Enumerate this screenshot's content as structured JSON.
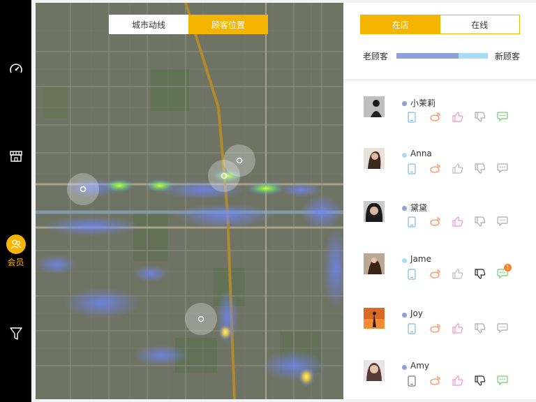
{
  "nav": {
    "items": [
      {
        "id": "dashboard",
        "icon": "speedometer-icon",
        "active": false
      },
      {
        "id": "store",
        "icon": "store-icon",
        "active": false
      },
      {
        "id": "members",
        "icon": "members-icon",
        "active": true,
        "label": "会员"
      },
      {
        "id": "funnel",
        "icon": "funnel-icon",
        "active": false
      }
    ],
    "active_color": "#f5b400"
  },
  "map": {
    "toggle": {
      "city_route": "城市动线",
      "customer_location": "顾客位置",
      "selected": "customer_location"
    }
  },
  "panel": {
    "tabs": {
      "in_store": "在店",
      "online": "在线",
      "selected": "in_store"
    },
    "ratio": {
      "old_label": "老顾客",
      "new_label": "新顾客",
      "old_fraction": 0.68,
      "old_color": "#8f9fdc",
      "new_color": "#a8dcf4"
    },
    "customers": [
      {
        "name": "小茉莉",
        "dot": "#8f9fdc",
        "wechat_badge": null
      },
      {
        "name": "Anna",
        "dot": "#a8dcf4",
        "wechat_badge": null
      },
      {
        "name": "黛黛",
        "dot": "#8f9fdc",
        "wechat_badge": null
      },
      {
        "name": "Jame",
        "dot": "#a8dcf4",
        "wechat_badge": "1"
      },
      {
        "name": "Joy",
        "dot": "#8f9fdc",
        "wechat_badge": null
      },
      {
        "name": "Amy",
        "dot": "#8f9fdc",
        "wechat_badge": null
      }
    ]
  }
}
